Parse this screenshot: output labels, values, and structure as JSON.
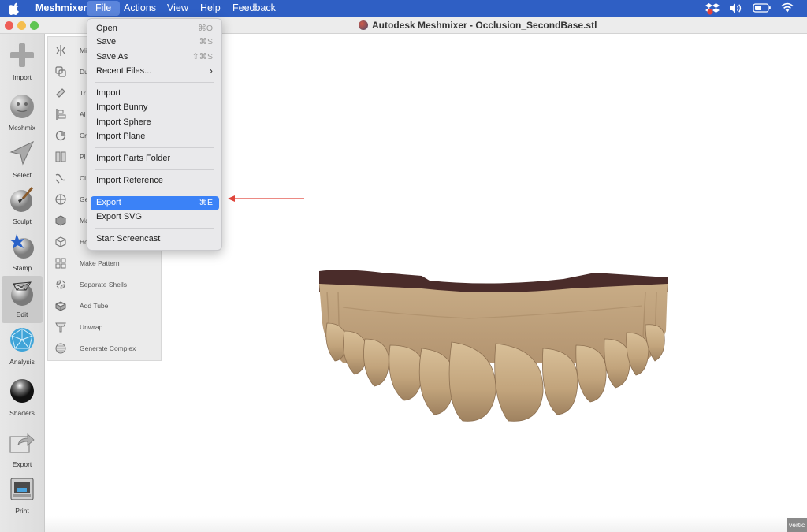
{
  "menubar": {
    "apple_icon": "apple-icon",
    "app_name": "Meshmixer",
    "items": [
      "File",
      "Actions",
      "View",
      "Help",
      "Feedback"
    ],
    "active_item": "File",
    "status_icons": [
      "dropbox-icon",
      "volume-icon",
      "battery-icon",
      "wifi-icon"
    ]
  },
  "window": {
    "title": "Autodesk Meshmixer - Occlusion_SecondBase.stl",
    "traffic_colors": [
      "#ee5e57",
      "#f5be4f",
      "#5fc553"
    ]
  },
  "toolbar": {
    "tools": [
      {
        "label": "Import",
        "icon": "plus-icon"
      },
      {
        "label": "Meshmix",
        "icon": "bunny-head-icon"
      },
      {
        "label": "Select",
        "icon": "arrow-cursor-icon"
      },
      {
        "label": "Sculpt",
        "icon": "brush-sphere-icon"
      },
      {
        "label": "Stamp",
        "icon": "stamp-sphere-icon"
      },
      {
        "label": "Edit",
        "icon": "edit-sphere-icon"
      },
      {
        "label": "Analysis",
        "icon": "analysis-mesh-icon"
      },
      {
        "label": "Shaders",
        "icon": "shader-sphere-icon"
      },
      {
        "label": "Export",
        "icon": "export-icon"
      },
      {
        "label": "Print",
        "icon": "printer-icon"
      }
    ],
    "active": "Edit"
  },
  "edit_panel": {
    "items": [
      {
        "label": "Mi",
        "icon": "mirror-icon"
      },
      {
        "label": "Du",
        "icon": "duplicate-icon"
      },
      {
        "label": "Tr",
        "icon": "transform-icon"
      },
      {
        "label": "Al",
        "icon": "align-icon"
      },
      {
        "label": "Cr",
        "icon": "create-pivot-icon"
      },
      {
        "label": "Pl",
        "icon": "plane-cut-icon"
      },
      {
        "label": "Cl",
        "icon": "close-cracks-icon"
      },
      {
        "label": "Ge",
        "icon": "generate-face-groups-icon"
      },
      {
        "label": "Ma",
        "icon": "make-solid-icon"
      },
      {
        "label": "Ho",
        "icon": "hollow-icon"
      },
      {
        "label": "Make Pattern",
        "icon": "make-pattern-icon"
      },
      {
        "label": "Separate Shells",
        "icon": "separate-shells-icon"
      },
      {
        "label": "Add Tube",
        "icon": "add-tube-icon"
      },
      {
        "label": "Unwrap",
        "icon": "unwrap-icon"
      },
      {
        "label": "Generate Complex",
        "icon": "generate-complex-icon"
      }
    ]
  },
  "file_menu": {
    "items": [
      {
        "label": "Open",
        "shortcut": "⌘O"
      },
      {
        "label": "Save",
        "shortcut": "⌘S"
      },
      {
        "label": "Save As",
        "shortcut": "⇧⌘S"
      },
      {
        "label": "Recent Files...",
        "shortcut": "›"
      },
      {
        "label": "Import",
        "shortcut": ""
      },
      {
        "label": "Import Bunny",
        "shortcut": ""
      },
      {
        "label": "Import Sphere",
        "shortcut": ""
      },
      {
        "label": "Import Plane",
        "shortcut": ""
      },
      {
        "label": "Import Parts Folder",
        "shortcut": ""
      },
      {
        "label": "Import Reference",
        "shortcut": ""
      },
      {
        "label": "Export",
        "shortcut": "⌘E"
      },
      {
        "label": "Export SVG",
        "shortcut": ""
      },
      {
        "label": "Start Screencast",
        "shortcut": ""
      }
    ],
    "highlighted": "Export",
    "highlight_color": "#3b82f7"
  },
  "annotation": {
    "arrow_color": "#e0443a"
  },
  "model": {
    "base_color": "#c9ad88",
    "top_color": "#4a2c2a"
  },
  "footer": {
    "tag": "vertic"
  }
}
